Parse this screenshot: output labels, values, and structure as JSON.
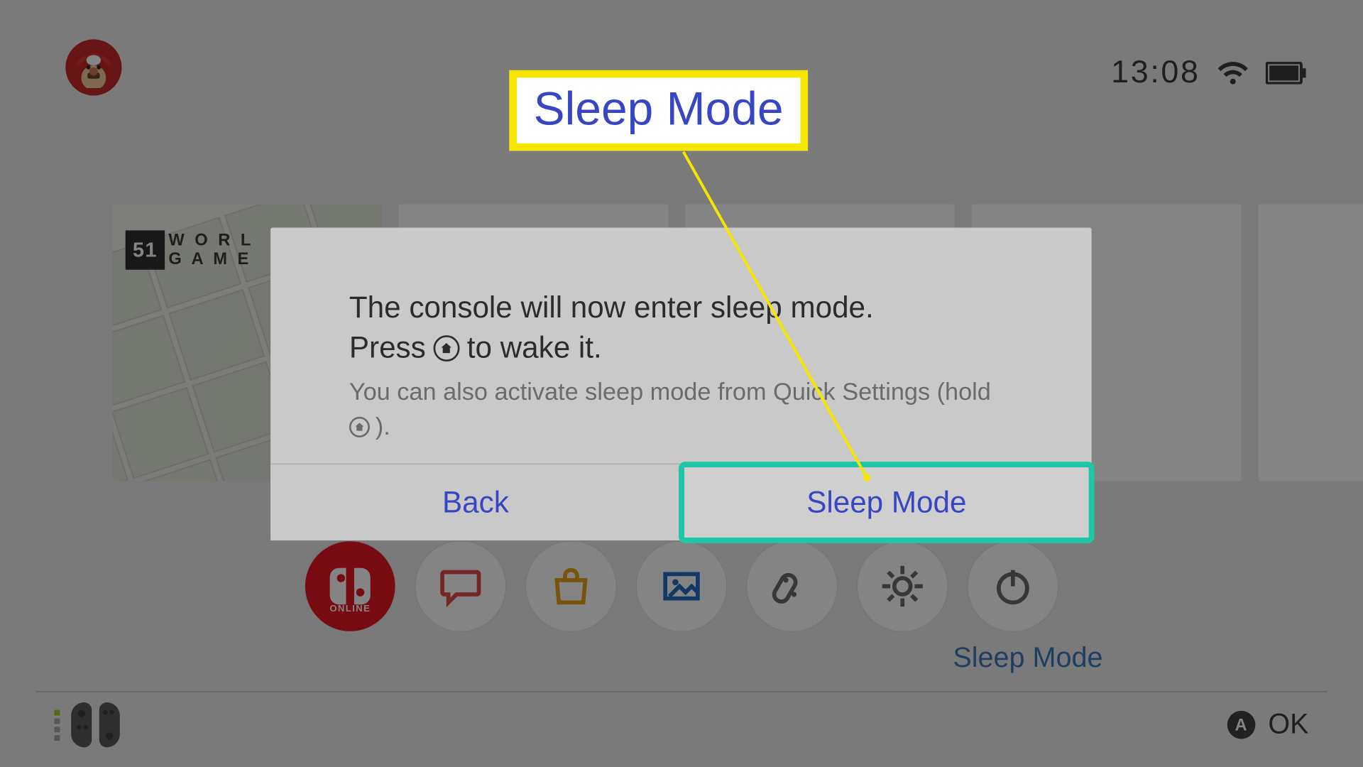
{
  "status": {
    "time": "13:08"
  },
  "tiles": {
    "first_badge": "51",
    "first_text_top": "W O R L",
    "first_text_bot": "G A M E"
  },
  "sysrow": {
    "online_label": "ONLINE",
    "selected_label": "Sleep Mode"
  },
  "dialog": {
    "line1": "The console will now enter sleep mode.",
    "line2_prefix": "Press",
    "line2_suffix": "to wake it.",
    "hint_prefix": "You can also activate sleep mode from Quick Settings (hold",
    "hint_suffix": ").",
    "back": "Back",
    "confirm": "Sleep Mode"
  },
  "callout": {
    "label": "Sleep Mode"
  },
  "footer": {
    "a": "A",
    "ok": "OK"
  }
}
